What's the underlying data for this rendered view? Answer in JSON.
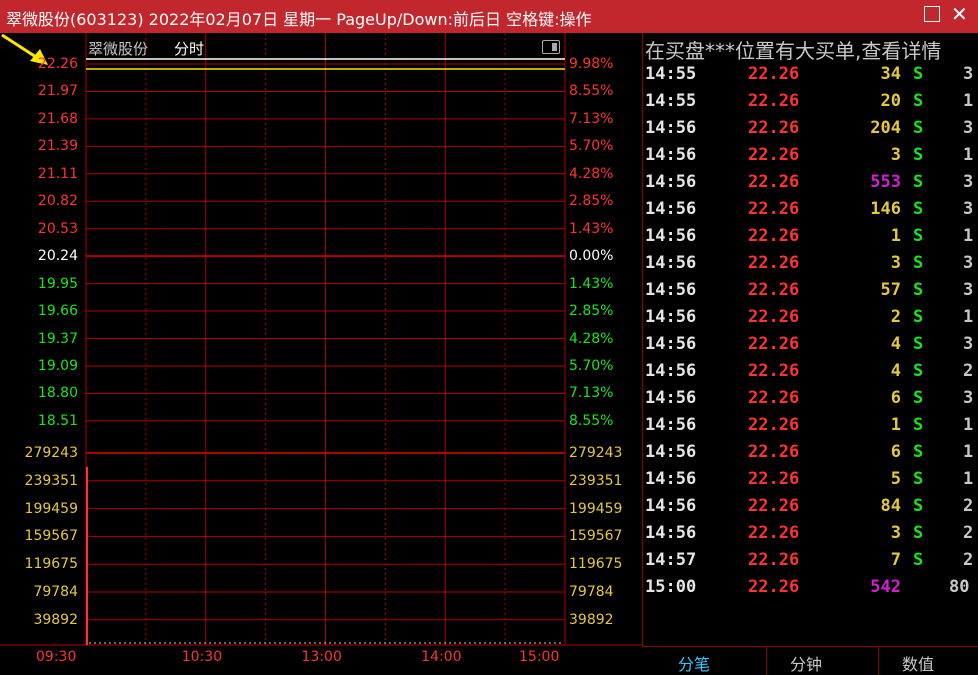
{
  "window": {
    "title": "翠微股份(603123) 2022年02月07日 星期一 PageUp/Down:前后日 空格键:操作",
    "maximize_icon": "square-outline-icon",
    "close_icon": "close-x-icon"
  },
  "chart_header": {
    "stock_name": "翠微股份",
    "view_label": "分时",
    "toggle_icon": "panel-toggle-icon",
    "arrow_icon": "yellow-arrow-icon"
  },
  "price_axis": {
    "left_labels": [
      "22.26",
      "21.97",
      "21.68",
      "21.39",
      "21.11",
      "20.82",
      "20.53",
      "20.24",
      "19.95",
      "19.66",
      "19.37",
      "19.09",
      "18.80",
      "18.51"
    ],
    "right_labels": [
      "9.98%",
      "8.55%",
      "7.13%",
      "5.70%",
      "4.28%",
      "2.85%",
      "1.43%",
      "0.00%",
      "1.43%",
      "2.85%",
      "4.28%",
      "5.70%",
      "7.13%",
      "8.55%"
    ],
    "colors": [
      "red",
      "red",
      "red",
      "red",
      "red",
      "red",
      "red",
      "white",
      "green",
      "green",
      "green",
      "green",
      "green",
      "green"
    ]
  },
  "volume_axis": {
    "labels": [
      "279243",
      "239351",
      "199459",
      "159567",
      "119675",
      "79784",
      "39892"
    ]
  },
  "time_axis": {
    "labels": [
      "09:30",
      "10:30",
      "13:00",
      "14:00",
      "15:00"
    ]
  },
  "chart_data": {
    "type": "line",
    "x": [
      "09:30",
      "15:00"
    ],
    "series": [
      {
        "values": [
          22.26,
          22.26
        ]
      }
    ],
    "ylim": [
      18.51,
      22.26
    ],
    "prev_close": 20.24,
    "volume_ylim": [
      0,
      279243
    ],
    "opening_volume_bar": 239351,
    "grid": true
  },
  "tick_panel": {
    "banner": "在买盘***位置有大买单,查看详情",
    "rows": [
      {
        "time": "14:55",
        "price": "22.26",
        "vol": "34",
        "vol_color": "yellow",
        "bs": "S",
        "n": "3"
      },
      {
        "time": "14:55",
        "price": "22.26",
        "vol": "20",
        "vol_color": "yellow",
        "bs": "S",
        "n": "1"
      },
      {
        "time": "14:56",
        "price": "22.26",
        "vol": "204",
        "vol_color": "yellow",
        "bs": "S",
        "n": "3"
      },
      {
        "time": "14:56",
        "price": "22.26",
        "vol": "3",
        "vol_color": "yellow",
        "bs": "S",
        "n": "1"
      },
      {
        "time": "14:56",
        "price": "22.26",
        "vol": "553",
        "vol_color": "magenta",
        "bs": "S",
        "n": "3"
      },
      {
        "time": "14:56",
        "price": "22.26",
        "vol": "146",
        "vol_color": "yellow",
        "bs": "S",
        "n": "3"
      },
      {
        "time": "14:56",
        "price": "22.26",
        "vol": "1",
        "vol_color": "yellow",
        "bs": "S",
        "n": "1"
      },
      {
        "time": "14:56",
        "price": "22.26",
        "vol": "3",
        "vol_color": "yellow",
        "bs": "S",
        "n": "3"
      },
      {
        "time": "14:56",
        "price": "22.26",
        "vol": "57",
        "vol_color": "yellow",
        "bs": "S",
        "n": "3"
      },
      {
        "time": "14:56",
        "price": "22.26",
        "vol": "2",
        "vol_color": "yellow",
        "bs": "S",
        "n": "1"
      },
      {
        "time": "14:56",
        "price": "22.26",
        "vol": "4",
        "vol_color": "yellow",
        "bs": "S",
        "n": "3"
      },
      {
        "time": "14:56",
        "price": "22.26",
        "vol": "4",
        "vol_color": "yellow",
        "bs": "S",
        "n": "2"
      },
      {
        "time": "14:56",
        "price": "22.26",
        "vol": "6",
        "vol_color": "yellow",
        "bs": "S",
        "n": "3"
      },
      {
        "time": "14:56",
        "price": "22.26",
        "vol": "1",
        "vol_color": "yellow",
        "bs": "S",
        "n": "1"
      },
      {
        "time": "14:56",
        "price": "22.26",
        "vol": "6",
        "vol_color": "yellow",
        "bs": "S",
        "n": "1"
      },
      {
        "time": "14:56",
        "price": "22.26",
        "vol": "5",
        "vol_color": "yellow",
        "bs": "S",
        "n": "1"
      },
      {
        "time": "14:56",
        "price": "22.26",
        "vol": "84",
        "vol_color": "yellow",
        "bs": "S",
        "n": "2"
      },
      {
        "time": "14:56",
        "price": "22.26",
        "vol": "3",
        "vol_color": "yellow",
        "bs": "S",
        "n": "2"
      },
      {
        "time": "14:57",
        "price": "22.26",
        "vol": "7",
        "vol_color": "yellow",
        "bs": "S",
        "n": "2"
      },
      {
        "time": "15:00",
        "price": "22.26",
        "vol": "542",
        "vol_color": "magenta",
        "bs": "",
        "n": "80"
      }
    ]
  },
  "bottom_tabs": [
    {
      "label": "分笔",
      "color": "#37c8ff"
    },
    {
      "label": "分钟",
      "color": "#c8c8c8"
    },
    {
      "label": "数值",
      "color": "#c8c8c8"
    }
  ]
}
